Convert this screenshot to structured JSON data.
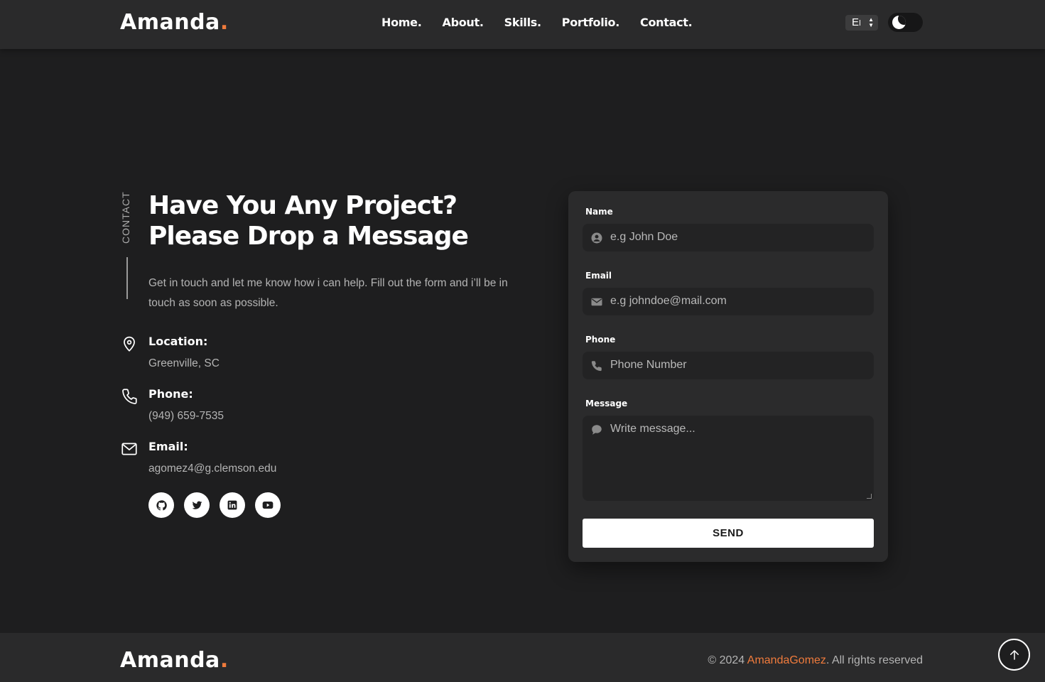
{
  "brand": {
    "name": "Amanda",
    "dot": "."
  },
  "nav": {
    "items": [
      "Home.",
      "About.",
      "Skills.",
      "Portfolio.",
      "Contact."
    ]
  },
  "language": {
    "selected": "En"
  },
  "theme": {
    "mode": "dark",
    "icon": "moon-icon"
  },
  "contact": {
    "section_label": "CONTACT",
    "title_line1": "Have You Any Project?",
    "title_line2": "Please Drop a Message",
    "intro": "Get in touch and let me know how i can help. Fill out the form and i’ll be in touch as soon as possible.",
    "location": {
      "label": "Location:",
      "value": "Greenville, SC",
      "icon": "map-pin-icon"
    },
    "phone": {
      "label": "Phone:",
      "value": "(949) 659-7535",
      "icon": "phone-icon"
    },
    "email": {
      "label": "Email:",
      "value": "agomez4@g.clemson.edu",
      "icon": "mail-icon"
    },
    "socials": [
      "github-icon",
      "twitter-icon",
      "linkedin-icon",
      "youtube-icon"
    ]
  },
  "form": {
    "name_label": "Name",
    "name_placeholder": "e.g John Doe",
    "email_label": "Email",
    "email_placeholder": "e.g johndoe@mail.com",
    "phone_label": "Phone",
    "phone_placeholder": "Phone Number",
    "message_label": "Message",
    "message_placeholder": "Write message...",
    "send_label": "SEND"
  },
  "footer": {
    "copyright_prefix": "© 2024 ",
    "copyright_name": "AmandaGomez",
    "copyright_suffix": ". All rights reserved"
  },
  "colors": {
    "accent": "#f07b3c",
    "background": "#1e1e1f",
    "panel": "#2b2b2c"
  }
}
